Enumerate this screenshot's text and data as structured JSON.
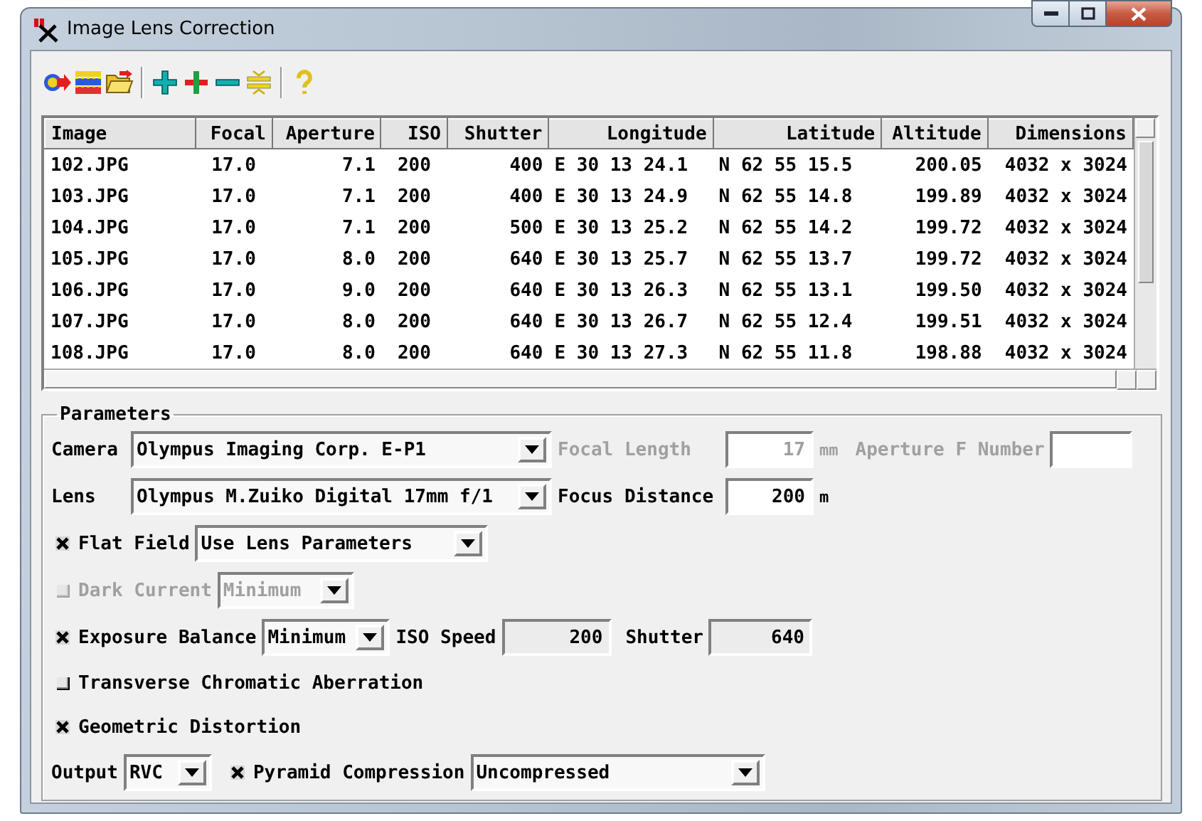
{
  "window": {
    "title": "Image Lens Correction"
  },
  "table": {
    "columns": [
      "Image",
      "Focal",
      "Aperture",
      "ISO",
      "Shutter",
      "Longitude",
      "Latitude",
      "Altitude",
      "Dimensions"
    ],
    "rows": [
      [
        "102.JPG",
        "17.0",
        "7.1",
        "200",
        "400",
        "E 30 13 24.1",
        "N 62 55 15.5",
        "200.05",
        "4032 x 3024"
      ],
      [
        "103.JPG",
        "17.0",
        "7.1",
        "200",
        "400",
        "E 30 13 24.9",
        "N 62 55 14.8",
        "199.89",
        "4032 x 3024"
      ],
      [
        "104.JPG",
        "17.0",
        "7.1",
        "200",
        "500",
        "E 30 13 25.2",
        "N 62 55 14.2",
        "199.72",
        "4032 x 3024"
      ],
      [
        "105.JPG",
        "17.0",
        "8.0",
        "200",
        "640",
        "E 30 13 25.7",
        "N 62 55 13.7",
        "199.72",
        "4032 x 3024"
      ],
      [
        "106.JPG",
        "17.0",
        "9.0",
        "200",
        "640",
        "E 30 13 26.3",
        "N 62 55 13.1",
        "199.50",
        "4032 x 3024"
      ],
      [
        "107.JPG",
        "17.0",
        "8.0",
        "200",
        "640",
        "E 30 13 26.7",
        "N 62 55 12.4",
        "199.51",
        "4032 x 3024"
      ],
      [
        "108.JPG",
        "17.0",
        "8.0",
        "200",
        "640",
        "E 30 13 27.3",
        "N 62 55 11.8",
        "198.88",
        "4032 x 3024"
      ]
    ]
  },
  "parameters": {
    "title": "Parameters",
    "camera": {
      "label": "Camera",
      "value": "Olympus Imaging Corp. E-P1"
    },
    "focal_length": {
      "label": "Focal Length",
      "value": "17",
      "unit": "mm",
      "disabled": true
    },
    "aperture_f_number": {
      "label": "Aperture F Number",
      "disabled": true
    },
    "lens": {
      "label": "Lens",
      "value": "Olympus M.Zuiko Digital 17mm f/1"
    },
    "focus_distance": {
      "label": "Focus Distance",
      "value": "200",
      "unit": "m",
      "disabled": false
    },
    "flat_field": {
      "label": "Flat Field",
      "checked": true,
      "disabled": false,
      "mode": "Use Lens Parameters"
    },
    "dark_current": {
      "label": "Dark Current",
      "checked": false,
      "disabled": true,
      "mode": "Minimum"
    },
    "exposure_balance": {
      "label": "Exposure Balance",
      "checked": true,
      "disabled": false,
      "mode": "Minimum"
    },
    "iso_speed": {
      "label": "ISO Speed",
      "value": "200",
      "readonly": true
    },
    "shutter": {
      "label": "Shutter",
      "value": "640",
      "readonly": true
    },
    "transverse_chromatic_aberration": {
      "label": "Transverse Chromatic Aberration",
      "checked": false,
      "disabled": false
    },
    "geometric_distortion": {
      "label": "Geometric Distortion",
      "checked": true,
      "disabled": false
    },
    "output": {
      "label": "Output",
      "value": "RVC"
    },
    "pyramid_compression": {
      "label": "Pyramid Compression",
      "checked": true,
      "disabled": false,
      "mode": "Uncompressed"
    }
  }
}
